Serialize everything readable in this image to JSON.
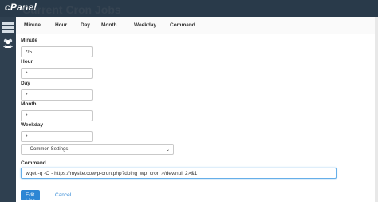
{
  "header": {
    "logo": "cPanel",
    "page_heading": "Current Cron Jobs"
  },
  "tabs": [
    "Minute",
    "Hour",
    "Day",
    "Month",
    "Weekday",
    "Command"
  ],
  "form": {
    "minute": {
      "label": "Minute",
      "value": "*/5"
    },
    "hour": {
      "label": "Hour",
      "value": "*"
    },
    "day": {
      "label": "Day",
      "value": "*"
    },
    "month": {
      "label": "Month",
      "value": "*"
    },
    "weekday": {
      "label": "Weekday",
      "value": "*"
    },
    "common_settings": {
      "selected": "-- Common Settings --"
    },
    "command": {
      "label": "Command",
      "value": "wget -q -O - https://mysite.co/wp-cron.php?doing_wp_cron >/dev/null 2>&1"
    }
  },
  "actions": {
    "edit_label": "Edit Line",
    "cancel_label": "Cancel"
  },
  "icons": {
    "sidebar_top": "grid-icon",
    "sidebar_users": "users-icon",
    "select_chevron": "chevron-down-icon"
  },
  "colors": {
    "topbar": "#293a4a",
    "sidebar": "#2f4050",
    "primary": "#2d86d4"
  }
}
